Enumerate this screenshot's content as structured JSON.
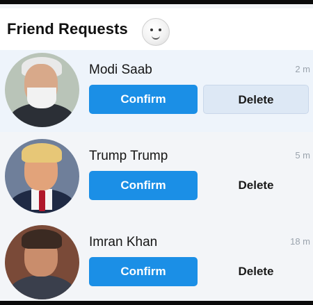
{
  "header": {
    "title": "Friend Requests"
  },
  "requests": [
    {
      "name": "Modi Saab",
      "time": "2 m",
      "confirm_label": "Confirm",
      "delete_label": "Delete"
    },
    {
      "name": "Trump Trump",
      "time": "5 m",
      "confirm_label": "Confirm",
      "delete_label": "Delete"
    },
    {
      "name": "Imran Khan",
      "time": "18 m",
      "confirm_label": "Confirm",
      "delete_label": "Delete"
    }
  ],
  "colors": {
    "confirm_button": "#1b8fe6",
    "delete_button_highlight": "#dde8f5",
    "background": "#f3f5f8"
  },
  "icons": {
    "header_emoji": "smiley-face-icon"
  }
}
